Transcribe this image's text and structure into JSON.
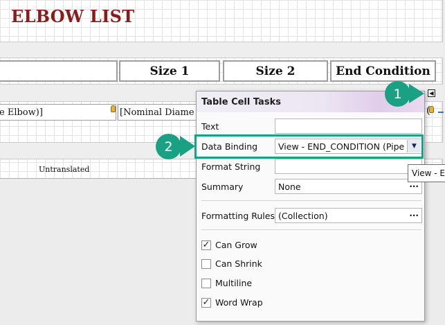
{
  "report": {
    "title": "ELBOW LIST",
    "header_cells": [
      "",
      "Size 1",
      "Size 2",
      "End Condition"
    ],
    "data_cells": [
      "e Elbow)]",
      "[Nominal Diame"
    ],
    "data_tail": "(",
    "footer_text": "Untranslated"
  },
  "popup": {
    "title": "Table Cell Tasks",
    "text_label": "Text",
    "text_value": "",
    "data_binding_label": "Data Binding",
    "data_binding_value": "View - END_CONDITION (Pipe",
    "format_string_label": "Format String",
    "format_string_value": "",
    "summary_label": "Summary",
    "summary_value": "None",
    "formatting_rules_label": "Formatting Rules",
    "formatting_rules_value": "(Collection)",
    "ellipsis": "···",
    "checkboxes": [
      {
        "label": "Can Grow",
        "checked": true
      },
      {
        "label": "Can Shrink",
        "checked": false
      },
      {
        "label": "Multiline",
        "checked": false
      },
      {
        "label": "Word Wrap",
        "checked": true
      }
    ]
  },
  "tooltip": {
    "text": "View - E"
  },
  "annotations": {
    "badge1": "1",
    "badge2": "2"
  },
  "colors": {
    "accent": "#1aa083",
    "title": "#8b1c1c",
    "selection": "#3e6fc9"
  },
  "icons": {
    "smart_tag": "smart-tag-chevron-left-icon",
    "dropdown": "chevron-down-icon",
    "check": "checkmark-icon",
    "db_field": "database-field-icon"
  }
}
